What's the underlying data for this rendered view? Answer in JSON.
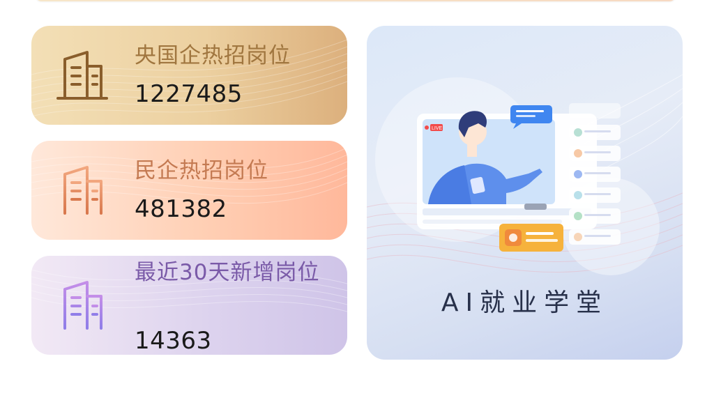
{
  "stats": [
    {
      "title": "央国企热招岗位",
      "value": "1227485",
      "icon": "building-icon",
      "accent": "#a0763f"
    },
    {
      "title": "民企热招岗位",
      "value": "481382",
      "icon": "building-icon",
      "accent": "#c47a52"
    },
    {
      "title": "最近30天新增岗位",
      "value": "14363",
      "icon": "building-icon",
      "accent": "#7a5aa8"
    }
  ],
  "ai_card": {
    "title": "AI就业学堂",
    "live_badge": "LIVE"
  }
}
